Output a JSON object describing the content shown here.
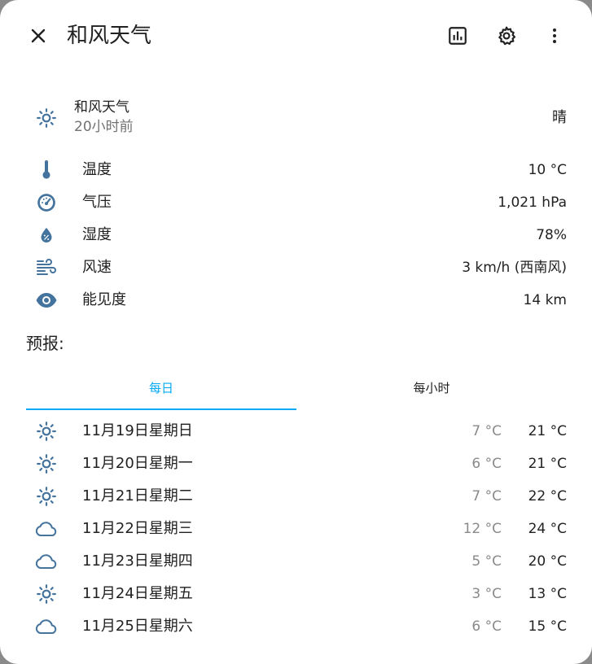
{
  "header": {
    "title": "和风天气",
    "close_icon": "close-icon",
    "history_icon": "chart-box-icon",
    "settings_icon": "gear-icon",
    "menu_icon": "dots-vertical-icon"
  },
  "state": {
    "name": "和风天气",
    "last_changed": "20小时前",
    "condition": "晴",
    "icon": "sunny-icon"
  },
  "attributes": [
    {
      "label": "温度",
      "value": "10 °C",
      "icon": "thermometer-icon"
    },
    {
      "label": "气压",
      "value": "1,021 hPa",
      "icon": "gauge-icon"
    },
    {
      "label": "湿度",
      "value": "78%",
      "icon": "water-percent-icon"
    },
    {
      "label": "风速",
      "value": "3 km/h (西南风)",
      "icon": "weather-windy-icon"
    },
    {
      "label": "能见度",
      "value": "14 km",
      "icon": "eye-icon"
    }
  ],
  "forecast": {
    "title": "预报:",
    "tabs": [
      {
        "label": "每日",
        "active": true
      },
      {
        "label": "每小时",
        "active": false
      }
    ],
    "days": [
      {
        "date": "11月19日星期日",
        "low": "7 °C",
        "high": "21 °C",
        "icon": "sunny-icon"
      },
      {
        "date": "11月20日星期一",
        "low": "6 °C",
        "high": "21 °C",
        "icon": "sunny-icon"
      },
      {
        "date": "11月21日星期二",
        "low": "7 °C",
        "high": "22 °C",
        "icon": "sunny-icon"
      },
      {
        "date": "11月22日星期三",
        "low": "12 °C",
        "high": "24 °C",
        "icon": "cloudy-icon"
      },
      {
        "date": "11月23日星期四",
        "low": "5 °C",
        "high": "20 °C",
        "icon": "cloudy-icon"
      },
      {
        "date": "11月24日星期五",
        "low": "3 °C",
        "high": "13 °C",
        "icon": "sunny-icon"
      },
      {
        "date": "11月25日星期六",
        "low": "6 °C",
        "high": "15 °C",
        "icon": "cloudy-icon"
      }
    ]
  },
  "colors": {
    "icon": "#44739e",
    "accent": "#03a9f4",
    "secondary_text": "#727272"
  }
}
